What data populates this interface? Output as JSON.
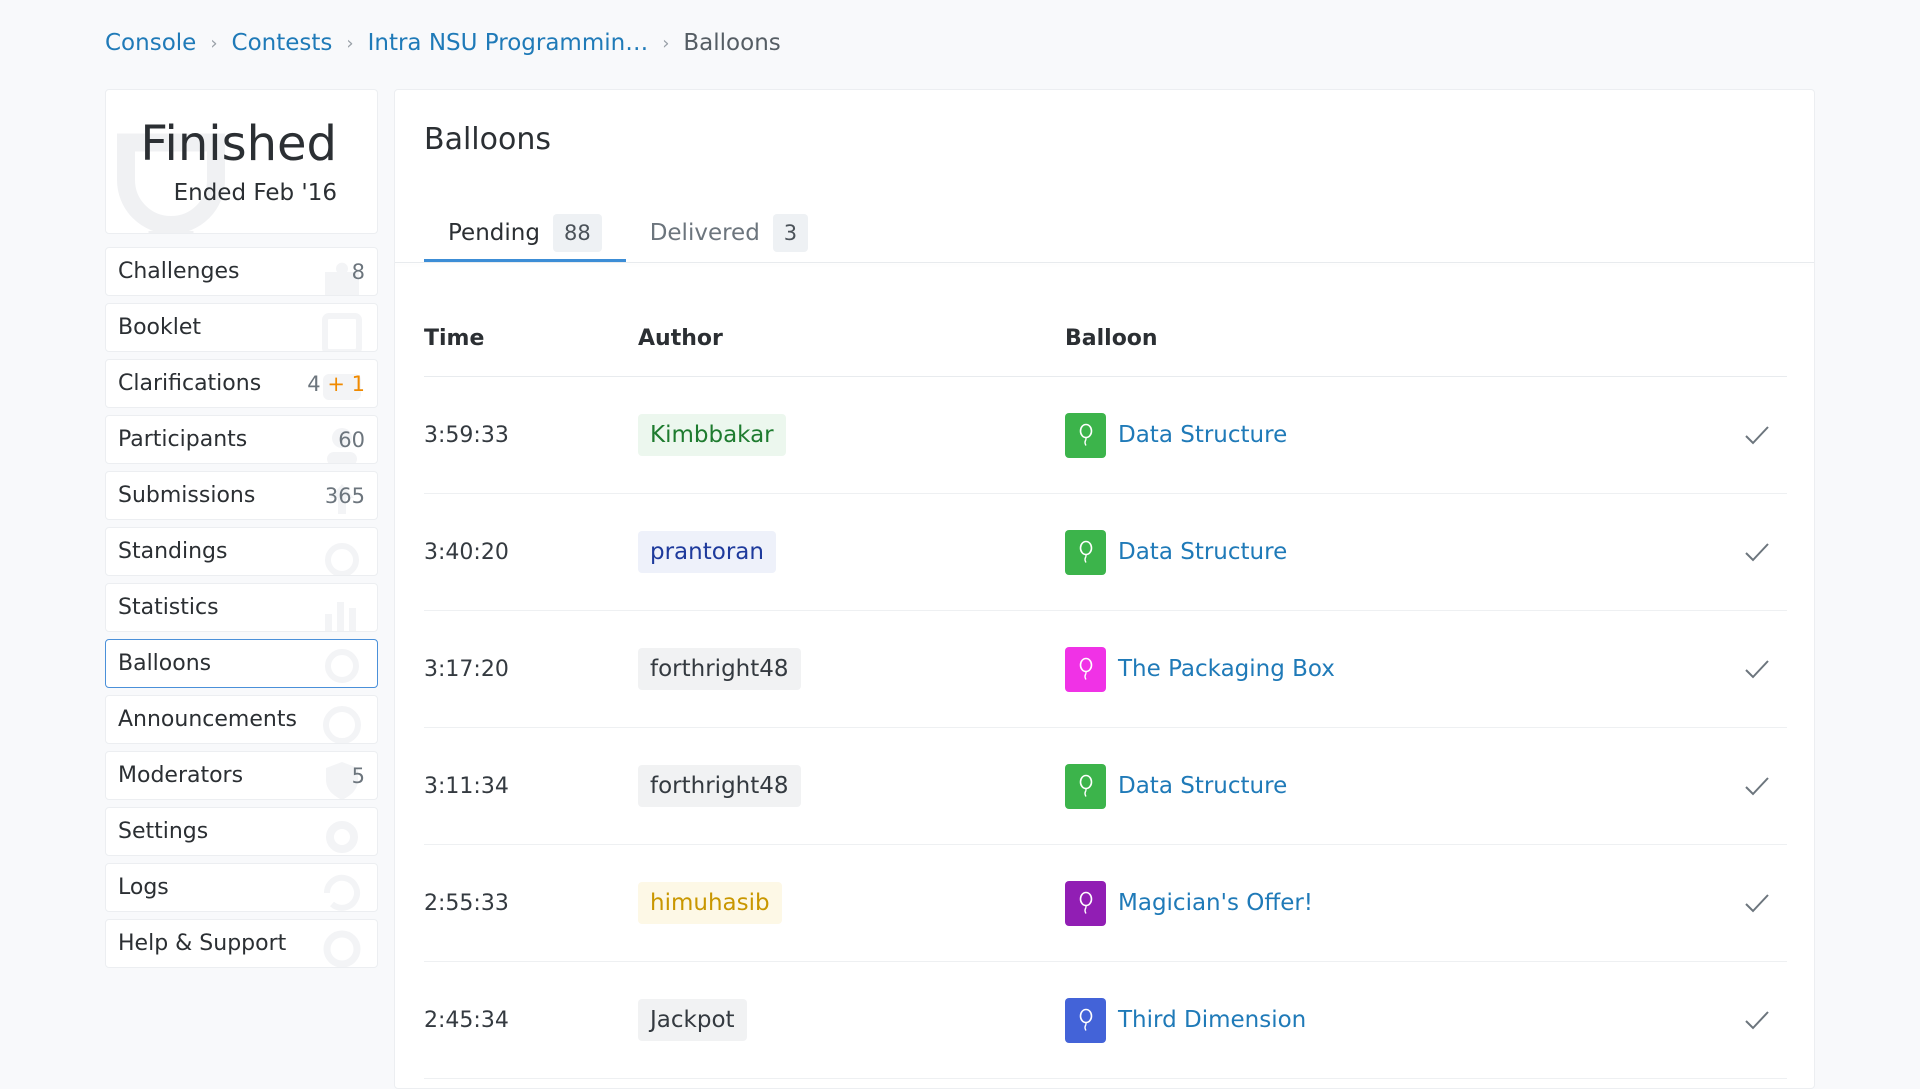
{
  "breadcrumb": {
    "items": [
      "Console",
      "Contests",
      "Intra NSU Programmin…"
    ],
    "current": "Balloons"
  },
  "status": {
    "title": "Finished",
    "subtitle": "Ended Feb '16"
  },
  "sidebar": {
    "items": [
      {
        "label": "Challenges",
        "count": "8",
        "extra": ""
      },
      {
        "label": "Booklet",
        "count": "",
        "extra": ""
      },
      {
        "label": "Clarifications",
        "count": "4",
        "extra": "+ 1"
      },
      {
        "label": "Participants",
        "count": "60",
        "extra": ""
      },
      {
        "label": "Submissions",
        "count": "365",
        "extra": ""
      },
      {
        "label": "Standings",
        "count": "",
        "extra": ""
      },
      {
        "label": "Statistics",
        "count": "",
        "extra": ""
      },
      {
        "label": "Balloons",
        "count": "",
        "extra": ""
      },
      {
        "label": "Announcements",
        "count": "",
        "extra": ""
      },
      {
        "label": "Moderators",
        "count": "5",
        "extra": ""
      },
      {
        "label": "Settings",
        "count": "",
        "extra": ""
      },
      {
        "label": "Logs",
        "count": "",
        "extra": ""
      },
      {
        "label": "Help & Support",
        "count": "",
        "extra": ""
      }
    ]
  },
  "main": {
    "title": "Balloons",
    "tabs": [
      {
        "label": "Pending",
        "count": "88"
      },
      {
        "label": "Delivered",
        "count": "3"
      }
    ],
    "columns": {
      "time": "Time",
      "author": "Author",
      "balloon": "Balloon"
    },
    "rows": [
      {
        "time": "3:59:33",
        "author": "Kimbbakar",
        "author_color": "#1e7b2f",
        "author_bg": "#ecf7ee",
        "balloon": "Data Structure",
        "balloon_color": "#3cb44b"
      },
      {
        "time": "3:40:20",
        "author": "prantoran",
        "author_color": "#1e3a9c",
        "author_bg": "#eef1fa",
        "balloon": "Data Structure",
        "balloon_color": "#3cb44b"
      },
      {
        "time": "3:17:20",
        "author": "forthright48",
        "author_color": "#343a40",
        "author_bg": "#f1f2f3",
        "balloon": "The Packaging Box",
        "balloon_color": "#f032e6"
      },
      {
        "time": "3:11:34",
        "author": "forthright48",
        "author_color": "#343a40",
        "author_bg": "#f1f2f3",
        "balloon": "Data Structure",
        "balloon_color": "#3cb44b"
      },
      {
        "time": "2:55:33",
        "author": "himuhasib",
        "author_color": "#c99700",
        "author_bg": "#fdf8e6",
        "balloon": "Magician's Offer!",
        "balloon_color": "#911eb4"
      },
      {
        "time": "2:45:34",
        "author": "Jackpot",
        "author_color": "#343a40",
        "author_bg": "#f1f2f3",
        "balloon": "Third Dimension",
        "balloon_color": "#4363d8"
      }
    ]
  },
  "colors": {
    "link": "#1f7ab8",
    "accent": "#3c8dd6",
    "clarification_extra": "#f08a00"
  }
}
